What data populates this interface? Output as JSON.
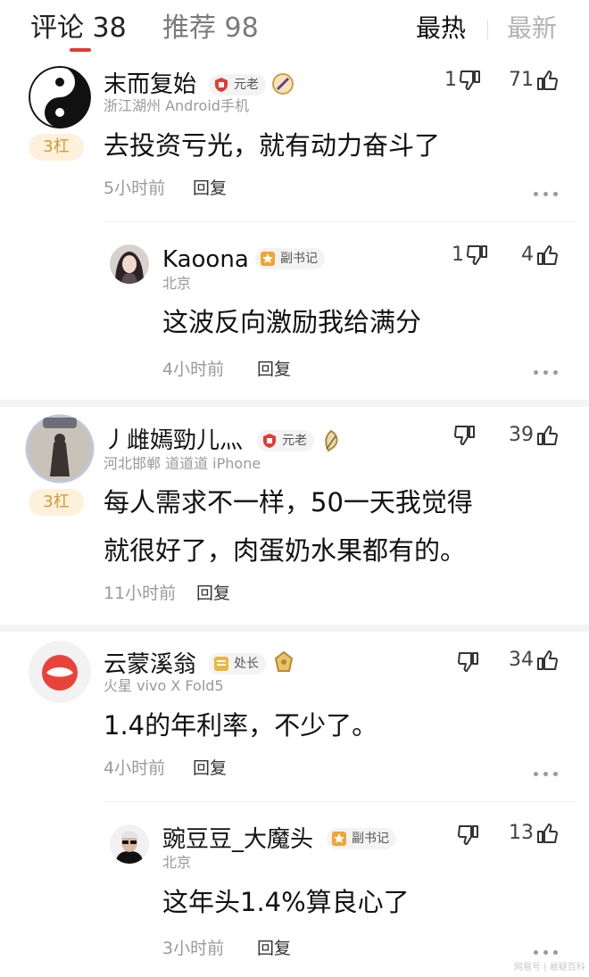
{
  "tabs": {
    "comments_label": "评论",
    "comments_count": "38",
    "recommend_label": "推荐",
    "recommend_count": "98",
    "sort_hot": "最热",
    "sort_new": "最新"
  },
  "comments": [
    {
      "name": "末而复始",
      "badge": "元老",
      "meta": "浙江湖州  Android手机",
      "tag": "3杠",
      "lines": [
        "去投资亏光，就有动力奋斗了"
      ],
      "time": "5小时前",
      "reply": "回复",
      "down": "1",
      "up": "71"
    },
    {
      "name": "Kaoona",
      "badge": "副书记",
      "meta": "北京",
      "lines": [
        "这波反向激励我给满分"
      ],
      "time": "4小时前",
      "reply": "回复",
      "down": "1",
      "up": "4"
    },
    {
      "name": "丿雌嫣勁儿灬",
      "badge": "元老",
      "meta": "河北邯郸  道道道  iPhone",
      "tag": "3杠",
      "lines": [
        "每人需求不一样，50一天我觉得",
        "就很好了，肉蛋奶水果都有的。"
      ],
      "time": "11小时前",
      "reply": "回复",
      "up": "39"
    },
    {
      "name": "云蒙溪翁",
      "badge": "处长",
      "meta": "火星  vivo X Fold5",
      "lines": [
        "1.4的年利率，不少了。"
      ],
      "time": "4小时前",
      "reply": "回复",
      "up": "34"
    },
    {
      "name": "豌豆豆_大魔头",
      "badge": "副书记",
      "meta": "北京",
      "lines": [
        "这年头1.4%算良心了"
      ],
      "time": "3小时前",
      "reply": "回复",
      "up": "13"
    }
  ],
  "watermark": "网易号 | 悬疑百科",
  "icons": {
    "thumb_up": "thumb-up-icon",
    "thumb_down": "thumb-down-icon",
    "more": "more-dots-icon"
  },
  "colors": {
    "accent": "#e53935",
    "tag_bg": "#fdf1dc",
    "tag_text": "#d49b3a"
  }
}
